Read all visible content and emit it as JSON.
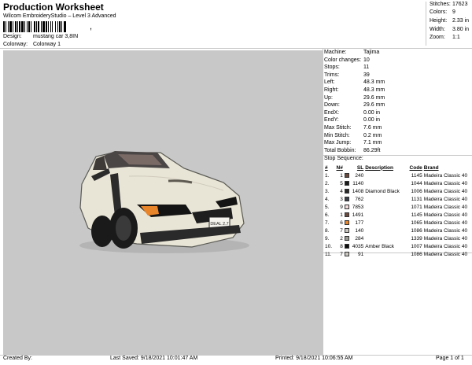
{
  "header": {
    "title": "Production Worksheet",
    "subtitle": "Wilcom EmbroideryStudio – Level 3 Advanced",
    "design_label": "Design:",
    "design_value": "mustang car 3,8IN",
    "colorway_label": "Colorway:",
    "colorway_value": "Colorway 1",
    "barcode_tail": ","
  },
  "stats": {
    "stitches_label": "Stitches:",
    "stitches_value": "17623",
    "colors_label": "Colors:",
    "colors_value": "9",
    "height_label": "Height:",
    "height_value": "2.33 in",
    "width_label": "Width:",
    "width_value": "3.80 in",
    "zoom_label": "Zoom:",
    "zoom_value": "1:1"
  },
  "info": [
    {
      "label": "Machine:",
      "value": "Tajima"
    },
    {
      "label": "Color changes:",
      "value": "10"
    },
    {
      "label": "Stops:",
      "value": "11"
    },
    {
      "label": "Trims:",
      "value": "39"
    },
    {
      "label": "Left:",
      "value": "48.3 mm"
    },
    {
      "label": "Right:",
      "value": "48.3 mm"
    },
    {
      "label": "Up:",
      "value": "29.6 mm"
    },
    {
      "label": "Down:",
      "value": "29.6 mm"
    },
    {
      "label": "EndX:",
      "value": "0.00 in"
    },
    {
      "label": "EndY:",
      "value": "0.00 in"
    },
    {
      "label": "Max Stitch:",
      "value": "7.6 mm"
    },
    {
      "label": "Min Stitch:",
      "value": "0.2 mm"
    },
    {
      "label": "Max Jump:",
      "value": "7.1 mm"
    },
    {
      "label": "Total Bobbin:",
      "value": "86.29ft"
    }
  ],
  "stop_sequence": {
    "title": "Stop Sequence:",
    "headers": {
      "num": "#",
      "n": "N#",
      "sl": "SL",
      "desc": "Description",
      "code": "Code",
      "brand": "Brand"
    },
    "rows": [
      {
        "num": "1.",
        "n": "1",
        "color": "#6b4a3e",
        "sl": "240",
        "desc": "",
        "code": "1145",
        "brand": "Madeira Classic 40"
      },
      {
        "num": "2.",
        "n": "5",
        "color": "#1c1c1c",
        "sl": "1140",
        "desc": "",
        "code": "1044",
        "brand": "Madeira Classic 40"
      },
      {
        "num": "3.",
        "n": "4",
        "color": "#2a2a2a",
        "sl": "1408",
        "desc": "Diamond Black",
        "code": "1006",
        "brand": "Madeira Classic 40"
      },
      {
        "num": "4.",
        "n": "3",
        "color": "#3a3f48",
        "sl": "762",
        "desc": "",
        "code": "1131",
        "brand": "Madeira Classic 40"
      },
      {
        "num": "5.",
        "n": "9",
        "color": "#f2dcdc",
        "sl": "7853",
        "desc": "",
        "code": "1071",
        "brand": "Madeira Classic 40"
      },
      {
        "num": "6.",
        "n": "1",
        "color": "#6b4a3e",
        "sl": "1491",
        "desc": "",
        "code": "1145",
        "brand": "Madeira Classic 40"
      },
      {
        "num": "7.",
        "n": "6",
        "color": "#e8842a",
        "sl": "177",
        "desc": "",
        "code": "1065",
        "brand": "Madeira Classic 40"
      },
      {
        "num": "8.",
        "n": "7",
        "color": "#c9c6bf",
        "sl": "140",
        "desc": "",
        "code": "1086",
        "brand": "Madeira Classic 40"
      },
      {
        "num": "9.",
        "n": "2",
        "color": "#9a9a92",
        "sl": "284",
        "desc": "",
        "code": "1339",
        "brand": "Madeira Classic 40"
      },
      {
        "num": "10.",
        "n": "8",
        "color": "#0e0e0e",
        "sl": "4035",
        "desc": "Amber Black",
        "code": "1007",
        "brand": "Madeira Classic 40"
      },
      {
        "num": "11.",
        "n": "7",
        "color": "#c9c6bf",
        "sl": "91",
        "desc": "",
        "code": "1086",
        "brand": "Madeira Classic 40"
      }
    ]
  },
  "footer": {
    "created": "Created By:",
    "saved": "Last Saved: 9/18/2021 10:01:47 AM",
    "printed": "Printed: 9/18/2021 10:06:55 AM",
    "page": "Page 1 of 1"
  },
  "license_plate": "DEAL 2.7",
  "colors": {
    "preview_bg": "#c8c8c8",
    "car_body": "#e9e5d6",
    "divider": "#c8c8c8"
  }
}
